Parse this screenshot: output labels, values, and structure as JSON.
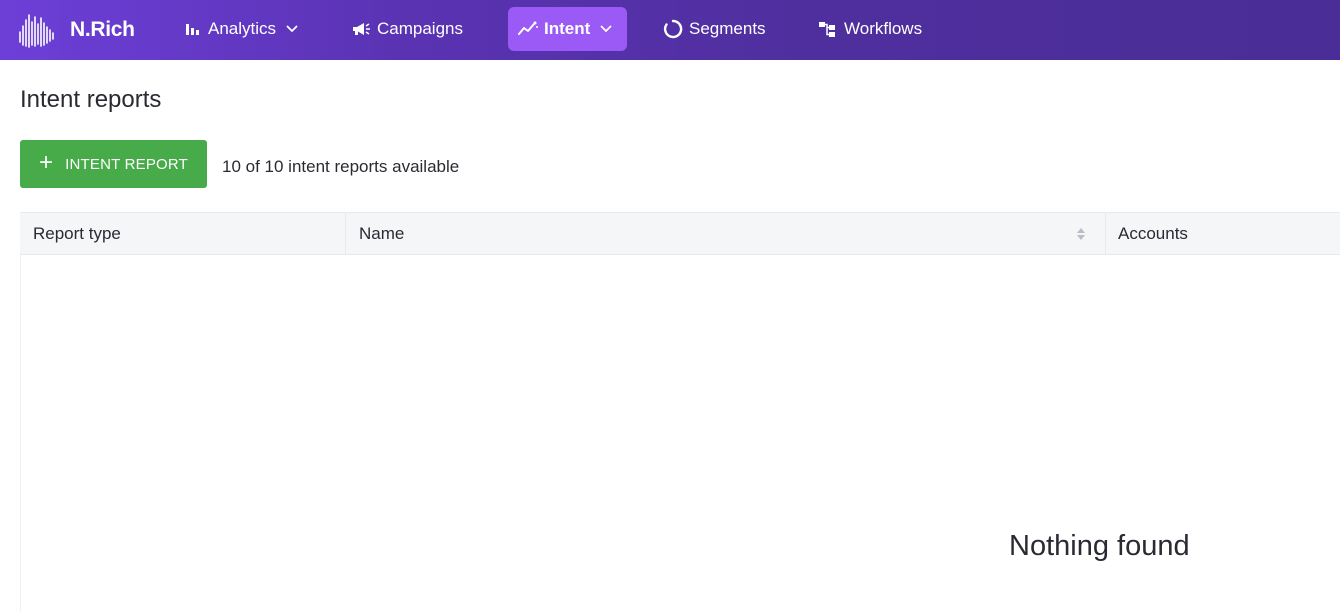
{
  "brand": {
    "name": "N.Rich",
    "logo_icon": "wave-bars-logo"
  },
  "nav": {
    "items": [
      {
        "label": "Analytics",
        "icon": "bar-chart-icon",
        "dropdown": true,
        "active": false
      },
      {
        "label": "Campaigns",
        "icon": "megaphone-icon",
        "dropdown": false,
        "active": false
      },
      {
        "label": "Intent",
        "icon": "trend-icon",
        "dropdown": true,
        "active": true
      },
      {
        "label": "Segments",
        "icon": "ring-icon",
        "dropdown": false,
        "active": false
      },
      {
        "label": "Workflows",
        "icon": "workflow-icon",
        "dropdown": false,
        "active": false
      }
    ]
  },
  "page": {
    "title": "Intent reports",
    "add_button_label": "INTENT REPORT",
    "count_text": "10 of 10 intent reports available"
  },
  "table": {
    "columns": [
      "Report type",
      "Name",
      "Accounts"
    ],
    "empty_text": "Nothing found"
  },
  "colors": {
    "nav_active": "#9b59f5",
    "add_button": "#47ab4a",
    "header_bg": "#f5f6f8"
  }
}
